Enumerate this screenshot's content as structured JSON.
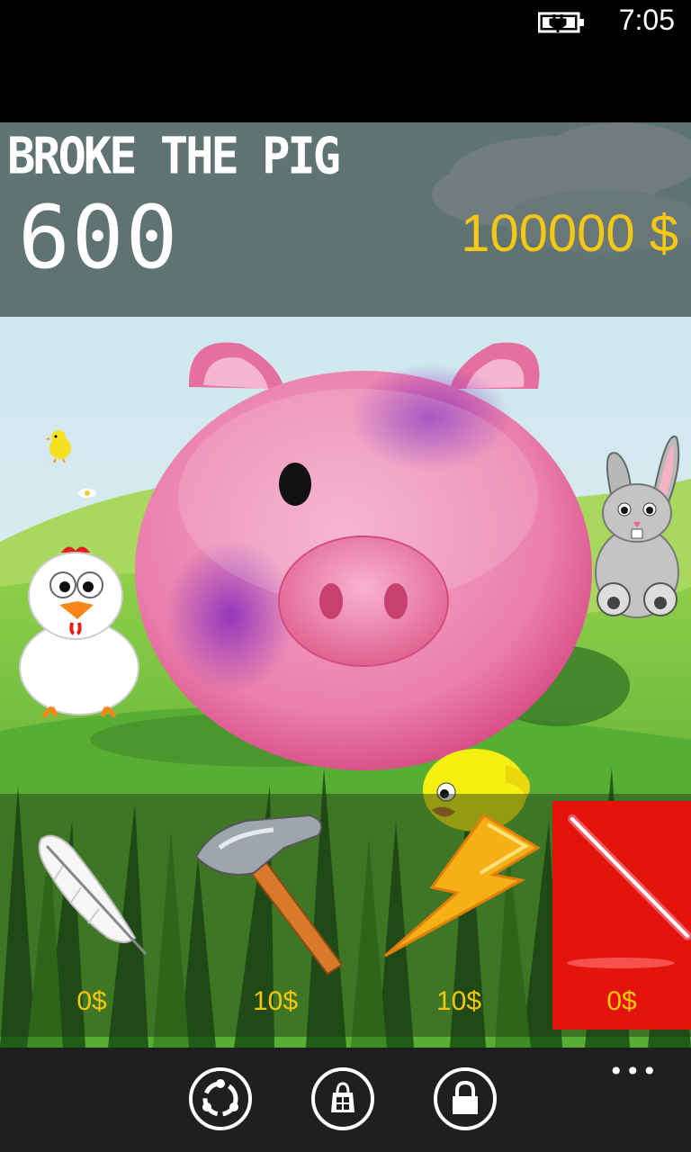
{
  "status": {
    "time": "7:05",
    "battery_icon": "battery-charging-icon"
  },
  "header": {
    "title": "Broke the pig",
    "score": "600",
    "money": "100000 $"
  },
  "scene": {
    "characters": [
      "pig-icon",
      "chicken-icon",
      "bunny-icon",
      "chick-icon",
      "small-chick-icon"
    ]
  },
  "tools": [
    {
      "name": "feather",
      "price": "0$",
      "selected": false
    },
    {
      "name": "hammer",
      "price": "10$",
      "selected": false
    },
    {
      "name": "lightning",
      "price": "10$",
      "selected": false
    },
    {
      "name": "lightsaber",
      "price": "0$",
      "selected": true
    }
  ],
  "appbar": {
    "buttons": [
      "refresh",
      "store",
      "lock"
    ],
    "more": "•••"
  },
  "colors": {
    "header_bg": "#5f7372",
    "money": "#f4c814",
    "price": "#f6c60e",
    "selected_tool": "#e3140c",
    "appbar": "#1f1f1f"
  }
}
